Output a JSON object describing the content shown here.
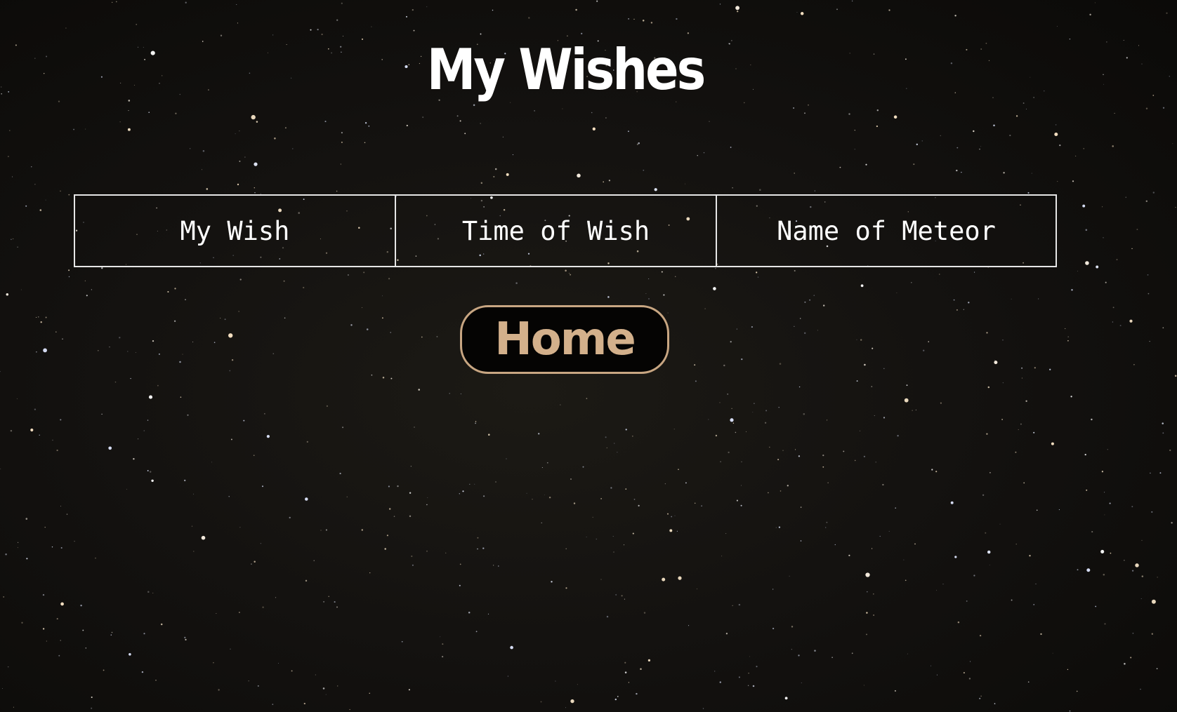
{
  "page": {
    "title": "My Wishes"
  },
  "table": {
    "headers": [
      "My Wish",
      "Time of Wish",
      "Name of Meteor"
    ]
  },
  "nav": {
    "home_label": "Home"
  },
  "colors": {
    "background": "#12100d",
    "title": "#ffffff",
    "table_border": "#e6e6e6",
    "button_background": "#050403",
    "button_text": "#d3b08b",
    "button_border": "#c8a682"
  }
}
